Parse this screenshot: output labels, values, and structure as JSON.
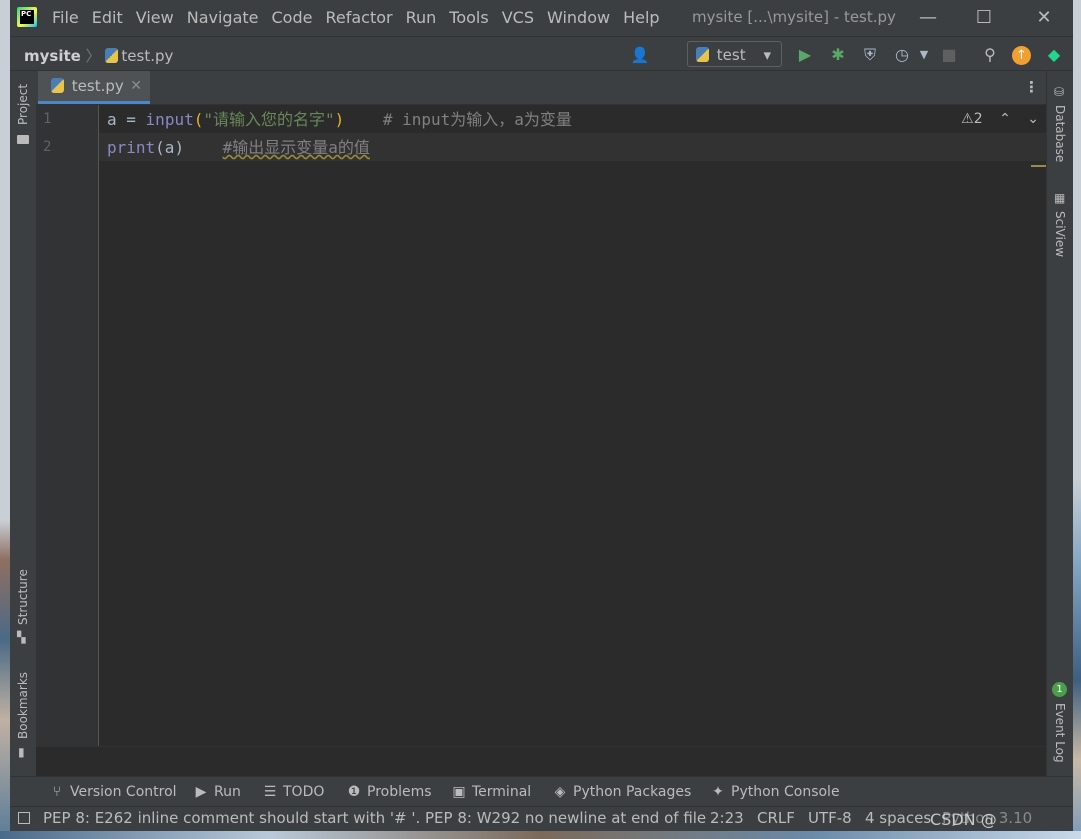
{
  "titlebar": {
    "logo_text": "PC",
    "menu": [
      "File",
      "Edit",
      "View",
      "Navigate",
      "Code",
      "Refactor",
      "Run",
      "Tools",
      "VCS",
      "Window",
      "Help"
    ],
    "window_title": "mysite [...\\mysite] - test.py",
    "minimize": "—",
    "maximize": "☐",
    "close": "✕"
  },
  "navbar": {
    "project": "mysite",
    "separator": "〉",
    "file": "test.py",
    "run_config": "test",
    "run_config_arrow": "▾"
  },
  "left_tools": {
    "project": "Project",
    "structure": "Structure",
    "bookmarks": "Bookmarks"
  },
  "right_tools": {
    "database": "Database",
    "sciview": "SciView",
    "event_log": "Event Log",
    "event_count": "1"
  },
  "tabs": [
    {
      "label": "test.py",
      "close": "✕"
    }
  ],
  "editor": {
    "line_numbers": [
      "1",
      "2"
    ],
    "line1": {
      "var": "a",
      "op": " = ",
      "func": "input",
      "open": "(",
      "string": "\"请输入您的名字\"",
      "close": ")",
      "gap": "    ",
      "comment": "# input为输入，a为变量"
    },
    "line2": {
      "func": "print",
      "args": "(a)",
      "gap": "    ",
      "comment": "#输出显示变量a的值"
    },
    "inspection_count": "2",
    "inspection_icon": "⚠",
    "nav_up": "⌃",
    "nav_down": "⌄"
  },
  "bottom_tools": [
    {
      "icon": "⑂",
      "label": "Version Control"
    },
    {
      "icon": "▶",
      "label": "Run"
    },
    {
      "icon": "☰",
      "label": "TODO"
    },
    {
      "icon": "❶",
      "label": "Problems"
    },
    {
      "icon": "▣",
      "label": "Terminal"
    },
    {
      "icon": "◈",
      "label": "Python Packages"
    },
    {
      "icon": "✦",
      "label": "Python Console"
    }
  ],
  "status": {
    "message": "PEP 8: E262 inline comment should start with '# '. PEP 8: W292 no newline at end of file",
    "position": "2:23",
    "line_sep": "CRLF",
    "encoding": "UTF-8",
    "indent": "4 spaces",
    "interpreter": "Python 3.10"
  },
  "watermark": "CSDN @"
}
